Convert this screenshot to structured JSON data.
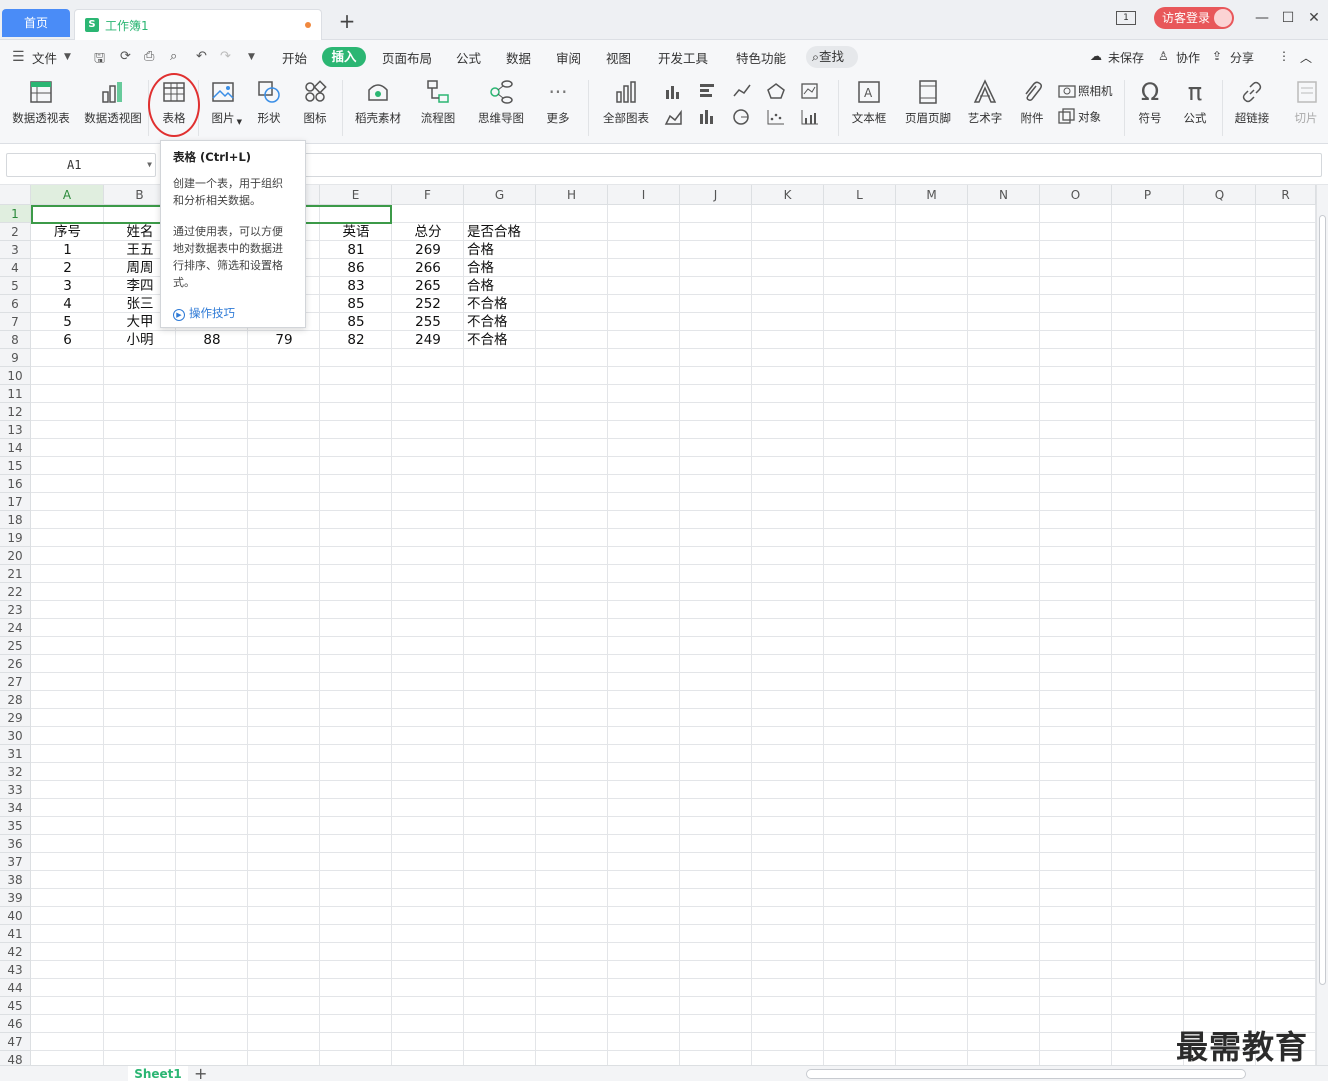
{
  "titlebar": {
    "home_tab": "首页",
    "doc_tab": "工作簿1",
    "doc_icon": "S",
    "page_icon_num": "1",
    "login": "访客登录",
    "minimize": "—",
    "maximize": "☐",
    "close": "✕",
    "add_tab": "+"
  },
  "menubar": {
    "file": "文件",
    "tabs": [
      "开始",
      "插入",
      "页面布局",
      "公式",
      "数据",
      "审阅",
      "视图",
      "开发工具",
      "特色功能"
    ],
    "active_tab": "插入",
    "search": "查找",
    "unsaved": "未保存",
    "collab": "协作",
    "share": "分享"
  },
  "ribbon": {
    "pivot_table": "数据透视表",
    "pivot_chart": "数据透视图",
    "table": "表格",
    "picture": "图片",
    "shape": "形状",
    "icon": "图标",
    "material": "稻壳素材",
    "flowchart": "流程图",
    "mindmap": "思维导图",
    "more": "更多",
    "all_charts": "全部图表",
    "textbox": "文本框",
    "header_footer": "页眉页脚",
    "wordart": "艺术字",
    "attachment": "附件",
    "camera": "照相机",
    "object": "对象",
    "symbol": "符号",
    "formula": "公式",
    "hyperlink": "超链接",
    "slicer": "切片"
  },
  "formula_bar": {
    "cell_ref": "A1"
  },
  "tooltip": {
    "title": "表格 (Ctrl+L)",
    "desc1": "创建一个表，用于组织和分析相关数据。",
    "desc2": "通过使用表，可以方便地对数据表中的数据进行排序、筛选和设置格式。",
    "link": "操作技巧"
  },
  "grid": {
    "columns": [
      "A",
      "B",
      "C",
      "D",
      "E",
      "F",
      "G",
      "H",
      "I",
      "J",
      "K",
      "L",
      "M",
      "N",
      "O",
      "P",
      "Q",
      "R"
    ],
    "selected_column": "A",
    "row_count": 48,
    "headers": [
      "序号",
      "姓名",
      "",
      "",
      "英语",
      "总分",
      "是否合格"
    ],
    "rows": [
      [
        "1",
        "王五",
        "",
        "",
        "81",
        "269",
        "合格"
      ],
      [
        "2",
        "周周",
        "",
        "",
        "86",
        "266",
        "合格"
      ],
      [
        "3",
        "李四",
        "",
        "",
        "83",
        "265",
        "合格"
      ],
      [
        "4",
        "张三",
        "",
        "",
        "85",
        "252",
        "不合格"
      ],
      [
        "5",
        "大甲",
        "",
        "",
        "85",
        "255",
        "不合格"
      ],
      [
        "6",
        "小明",
        "88",
        "79",
        "82",
        "249",
        "不合格"
      ]
    ]
  },
  "sheets": {
    "active": "Sheet1",
    "add": "+"
  },
  "watermark": "最需教育"
}
